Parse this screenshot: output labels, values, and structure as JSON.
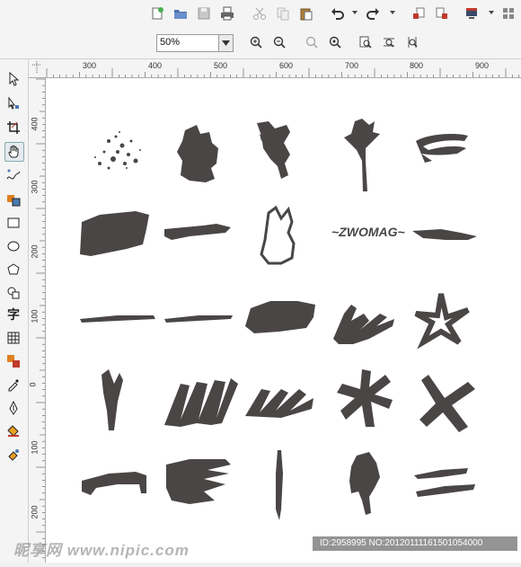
{
  "toolbar": {
    "buttons": [
      "new-document",
      "open",
      "save",
      "print",
      "cut",
      "copy",
      "paste",
      "undo",
      "redo",
      "import",
      "export",
      "application-launcher"
    ]
  },
  "zoom_toolbar": {
    "zoom_level": "50%"
  },
  "ruler_top": {
    "labels": [
      "300",
      "400",
      "500",
      "600",
      "700",
      "800",
      "900"
    ]
  },
  "ruler_left": {
    "labels": [
      "400",
      "300",
      "200",
      "100",
      "0",
      "100",
      "200"
    ]
  },
  "toolbox": {
    "tools": [
      "pick-tool",
      "shape-tool",
      "crop-tool",
      "pan-tool",
      "freehand-tool",
      "smart-fill-tool",
      "rectangle-tool",
      "ellipse-tool",
      "polygon-tool",
      "basic-shapes-tool",
      "text-tool",
      "table-tool",
      "blend-tool",
      "eyedropper-tool",
      "outline-pen-tool",
      "fill-tool",
      "interactive-fill-tool"
    ],
    "text_tool_glyph": "字"
  },
  "brush_grid": {
    "rows": 5,
    "columns": 5,
    "stroke_color": "#4a4646"
  },
  "watermark": {
    "site": "昵享网 www.nipic.com",
    "id_text": "ID:2958995 NO:20120111161501054000"
  }
}
